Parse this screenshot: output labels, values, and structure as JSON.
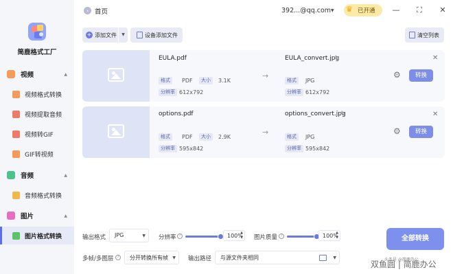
{
  "app": {
    "name": "简鹿格式工厂",
    "icon": "app-logo-cube"
  },
  "sidebar": {
    "categories": [
      {
        "label": "视频",
        "icon": "video-icon",
        "color": "#f29b5b",
        "expanded": true,
        "items": [
          {
            "label": "视频格式转换",
            "icon": "video-convert-icon",
            "color": "#f29b5b"
          },
          {
            "label": "视频提取音频",
            "icon": "extract-audio-icon",
            "color": "#f07a6a"
          },
          {
            "label": "视频转GIF",
            "icon": "gif-icon",
            "color": "#f07a6a"
          },
          {
            "label": "GIF转视频",
            "icon": "gif-video-icon",
            "color": "#f29b5b"
          }
        ]
      },
      {
        "label": "音频",
        "icon": "audio-icon",
        "color": "#4cc38a",
        "expanded": true,
        "items": [
          {
            "label": "音频格式转换",
            "icon": "audio-convert-icon",
            "color": "#f0b94a"
          }
        ]
      },
      {
        "label": "图片",
        "icon": "image-icon",
        "color": "#e56fc0",
        "expanded": true,
        "items": [
          {
            "label": "图片格式转换",
            "icon": "image-convert-icon",
            "color": "#5bc36a",
            "active": true
          }
        ]
      }
    ]
  },
  "topbar": {
    "back_icon": "arrow-left-icon",
    "home_label": "首页",
    "account": "392...@qq.com",
    "vip_label": "已开通",
    "vip_icon": "crown-icon"
  },
  "toolbar": {
    "add_file_label": "添加文件",
    "add_folder_label": "设备添加文件",
    "clear_label": "清空列表"
  },
  "files": [
    {
      "name": "EULA.pdf",
      "format_label": "格式",
      "format": "PDF",
      "size_label": "大小",
      "size": "3.1K",
      "res_label": "分辨率",
      "resolution": "612x792",
      "out_name": "EULA_convert.jpg",
      "out_format_label": "格式",
      "out_format": "JPG",
      "out_res_label": "分辨率",
      "out_resolution": "612x792",
      "convert_label": "转换"
    },
    {
      "name": "options.pdf",
      "format_label": "格式",
      "format": "PDF",
      "size_label": "大小",
      "size": "2.9K",
      "res_label": "分辨率",
      "resolution": "595x842",
      "out_name": "options_convert.jpg",
      "out_format_label": "格式",
      "out_format": "JPG",
      "out_res_label": "分辨率",
      "out_resolution": "595x842",
      "convert_label": "转换"
    }
  ],
  "settings": {
    "output_format_label": "输出格式",
    "output_format": "JPG",
    "resolution_label": "分辨率",
    "resolution_value": "100%",
    "resolution_level": 1.0,
    "quality_label": "图片质量",
    "quality_value": "100%",
    "quality_level": 1.0,
    "frames_label": "多帧/多图层",
    "frames_value": "分开转换所有帧",
    "output_path_label": "输出路径",
    "output_path_value": "与源文件夹相同",
    "convert_all_label": "全部转换"
  },
  "watermark": {
    "text": "双鱼圆 | 简鹿办公",
    "small": "头条号 @简鹿办公"
  }
}
